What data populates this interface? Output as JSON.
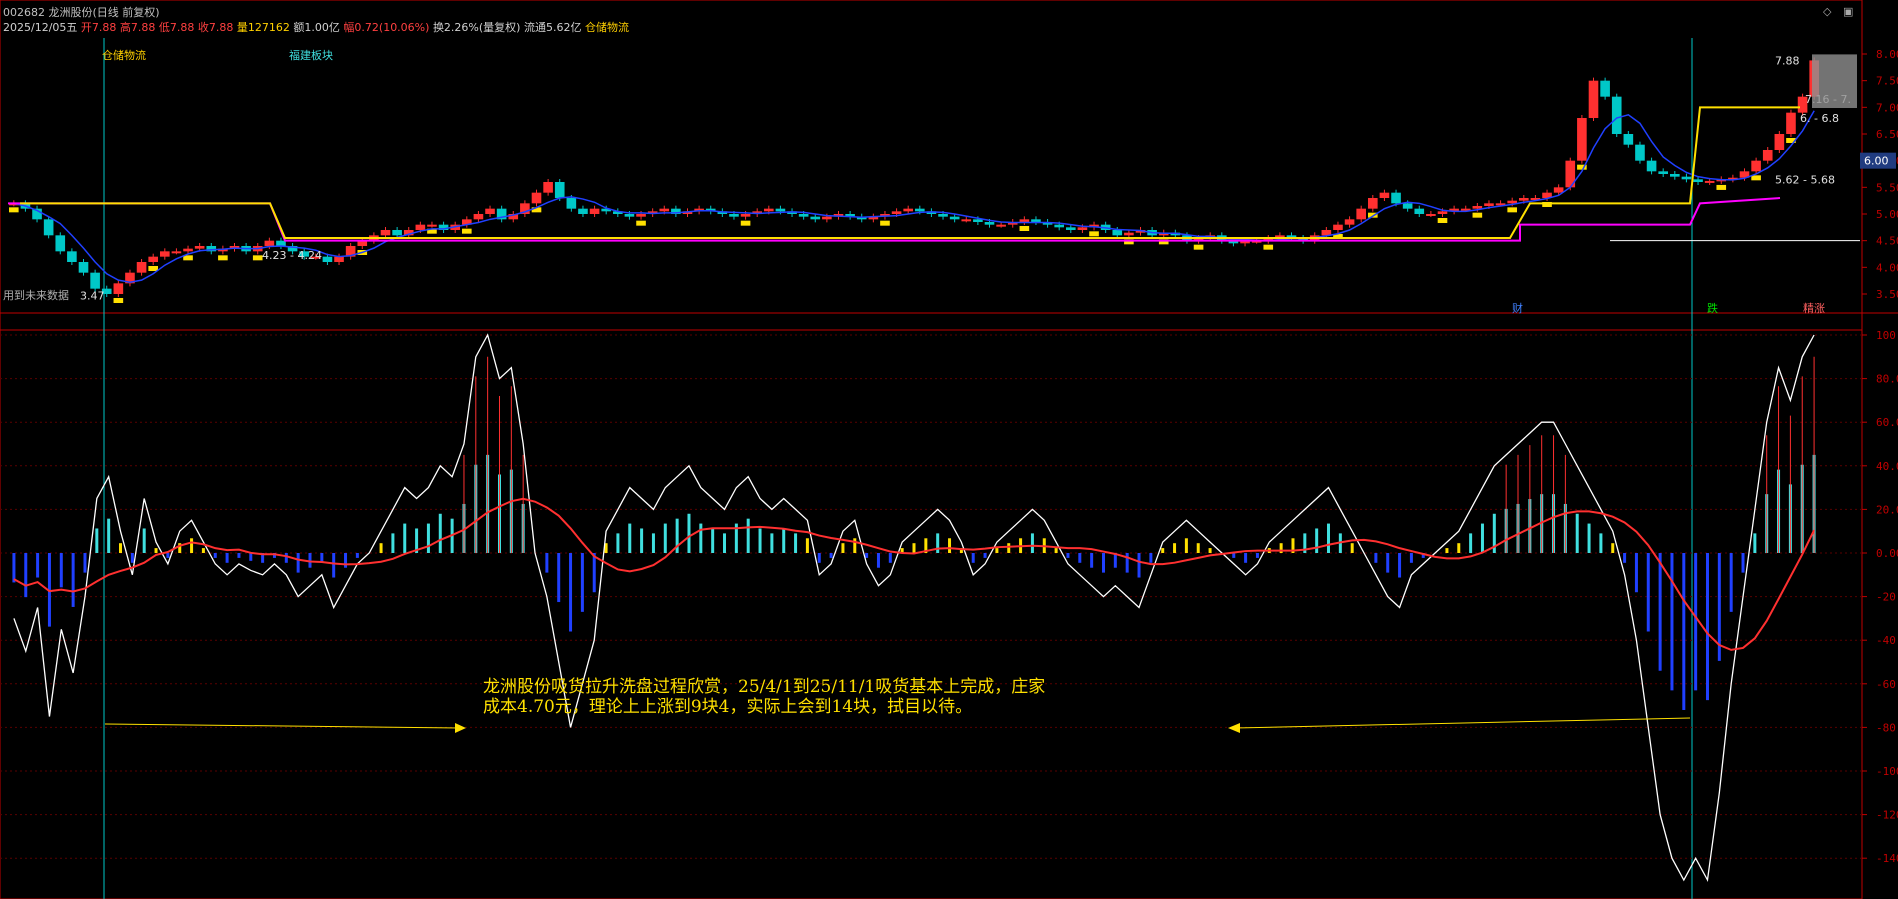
{
  "header": {
    "title": "002682 龙洲股份(日线 前复权)",
    "date": "2025/12/05五",
    "open": "开7.88",
    "high": "高7.88",
    "low": "低7.88",
    "close": "收7.88",
    "volume": "量127162",
    "amount": "额1.00亿",
    "change": "幅0.72(10.06%)",
    "turnover": "换2.26%(量复权)",
    "float": "流通5.62亿",
    "sector": "仓储物流"
  },
  "tags": {
    "sector1": "仓储物流",
    "sector2": "福建板块",
    "future": "用到未来数据",
    "cai": "财",
    "die": "跌",
    "jingzhang": "精涨"
  },
  "annotation": {
    "line1": "龙洲股份吸货拉升洗盘过程欣赏，25/4/1到25/11/1吸货基本上完成，庄家",
    "line2": "成本4.70元，理论上上涨到9块4，实际上会到14块，拭目以待。"
  },
  "colors": {
    "bg": "#000000",
    "up": "#ff3030",
    "down": "#00c8c8",
    "yellow": "#ffe000",
    "magenta": "#ff00ff",
    "blue": "#2040ff",
    "cyan_line": "#00c0c0",
    "white": "#ffffff",
    "grid": "#5a0000",
    "axis": "#c00000"
  },
  "chart_data": [
    {
      "type": "candlestick",
      "panel": "price",
      "ylim": [
        3.5,
        8.0
      ],
      "yticks": [
        "8.00",
        "7.50",
        "7.00",
        "6.50",
        "6.00",
        "5.50",
        "5.00",
        "4.50",
        "4.00",
        "3.50"
      ],
      "current_price": "6.00",
      "range_labels": [
        "7.88",
        "7.16 - 7.",
        "6.  - 6.8",
        "5.62 - 5.68",
        "4.23 - 4.24",
        "3.47"
      ],
      "close": [
        5.2,
        5.1,
        4.9,
        4.6,
        4.3,
        4.1,
        3.9,
        3.6,
        3.5,
        3.7,
        3.9,
        4.1,
        4.2,
        4.3,
        4.3,
        4.35,
        4.4,
        4.3,
        4.35,
        4.4,
        4.3,
        4.4,
        4.5,
        4.4,
        4.3,
        4.2,
        4.2,
        4.1,
        4.2,
        4.4,
        4.5,
        4.6,
        4.7,
        4.6,
        4.7,
        4.8,
        4.8,
        4.7,
        4.8,
        4.9,
        5.0,
        5.1,
        4.9,
        5.0,
        5.2,
        5.4,
        5.6,
        5.3,
        5.1,
        5.0,
        5.1,
        5.05,
        5.0,
        4.95,
        5.0,
        5.05,
        5.1,
        5.0,
        5.05,
        5.1,
        5.05,
        5.0,
        4.95,
        5.0,
        5.05,
        5.1,
        5.05,
        5.0,
        4.95,
        4.9,
        4.95,
        5.0,
        4.95,
        4.9,
        4.95,
        5.0,
        5.05,
        5.1,
        5.05,
        5.0,
        4.95,
        4.9,
        4.9,
        4.85,
        4.8,
        4.8,
        4.85,
        4.9,
        4.85,
        4.8,
        4.75,
        4.7,
        4.75,
        4.8,
        4.7,
        4.6,
        4.65,
        4.7,
        4.6,
        4.65,
        4.6,
        4.5,
        4.55,
        4.6,
        4.5,
        4.45,
        4.5,
        4.5,
        4.55,
        4.6,
        4.55,
        4.5,
        4.6,
        4.7,
        4.8,
        4.9,
        5.1,
        5.3,
        5.4,
        5.2,
        5.1,
        5.0,
        5.0,
        5.05,
        5.1,
        5.1,
        5.15,
        5.2,
        5.2,
        5.25,
        5.3,
        5.3,
        5.4,
        5.5,
        6.0,
        6.8,
        7.5,
        7.2,
        6.5,
        6.3,
        6.0,
        5.8,
        5.75,
        5.7,
        5.65,
        5.6,
        5.62,
        5.65,
        5.68,
        5.8,
        6.0,
        6.2,
        6.5,
        6.9,
        7.2,
        7.88
      ]
    },
    {
      "type": "line+bar",
      "panel": "oscillator",
      "ylim": [
        -150,
        100
      ],
      "yticks": [
        "100",
        "80.0",
        "60.0",
        "40.0",
        "20.0",
        "0.00",
        "-20.0",
        "-40.0",
        "-60.0",
        "-80.0",
        "-100",
        "-120",
        "-140"
      ],
      "white_line": [
        -30,
        -45,
        -25,
        -75,
        -35,
        -55,
        -20,
        25,
        35,
        10,
        -10,
        25,
        5,
        -5,
        10,
        15,
        5,
        -5,
        -10,
        -5,
        -8,
        -10,
        -5,
        -10,
        -20,
        -15,
        -10,
        -25,
        -15,
        -5,
        0,
        10,
        20,
        30,
        25,
        30,
        40,
        35,
        50,
        90,
        100,
        80,
        85,
        50,
        0,
        -20,
        -50,
        -80,
        -60,
        -40,
        10,
        20,
        30,
        25,
        20,
        30,
        35,
        40,
        30,
        25,
        20,
        30,
        35,
        25,
        20,
        25,
        20,
        15,
        -10,
        -5,
        10,
        15,
        -5,
        -15,
        -10,
        5,
        10,
        15,
        20,
        15,
        5,
        -10,
        -5,
        5,
        10,
        15,
        20,
        15,
        5,
        -5,
        -10,
        -15,
        -20,
        -15,
        -20,
        -25,
        -10,
        5,
        10,
        15,
        10,
        5,
        0,
        -5,
        -10,
        -5,
        5,
        10,
        15,
        20,
        25,
        30,
        20,
        10,
        0,
        -10,
        -20,
        -25,
        -10,
        -5,
        0,
        5,
        10,
        20,
        30,
        40,
        45,
        50,
        55,
        60,
        60,
        50,
        40,
        30,
        20,
        10,
        -10,
        -40,
        -80,
        -120,
        -140,
        -160,
        -140,
        -150,
        -110,
        -60,
        -20,
        20,
        60,
        85,
        70,
        90,
        100
      ]
    }
  ]
}
